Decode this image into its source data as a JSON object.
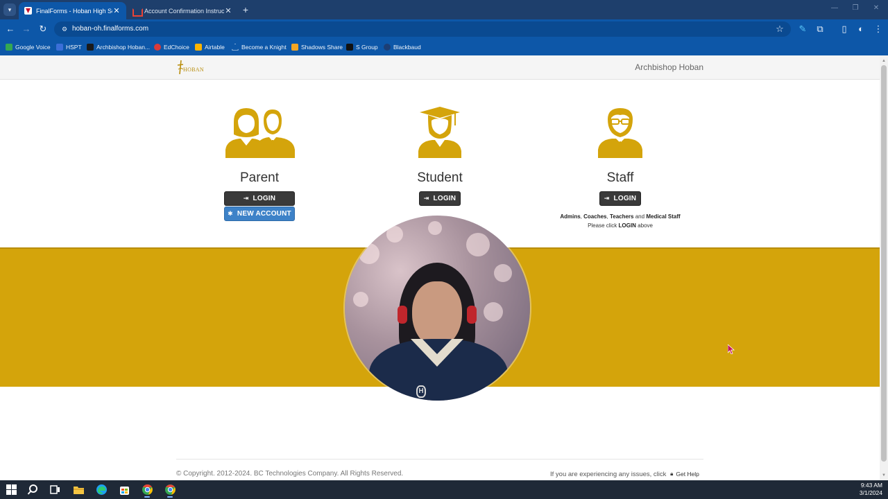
{
  "browser": {
    "tabs": [
      {
        "title": "FinalForms - Hoban High Scho",
        "active": true
      },
      {
        "title": "Account Confirmation Instructio",
        "active": false
      }
    ],
    "url": "hoban-oh.finalforms.com",
    "bookmarks": [
      {
        "label": "Google Voice",
        "color": "#34a853"
      },
      {
        "label": "HSPT",
        "color": "#3b6fd8"
      },
      {
        "label": "Archbishop Hoban...",
        "color": "#1a1a1a"
      },
      {
        "label": "EdChoice",
        "color": "#d93a3a"
      },
      {
        "label": "Airtable",
        "color": "#fcb400"
      },
      {
        "label": "Become a Knight",
        "color": "#ffffff"
      },
      {
        "label": "Shadows Share",
        "color": "#f5a623"
      },
      {
        "label": "S Group",
        "color": "#111111"
      },
      {
        "label": "Blackbaud",
        "color": "#1c3e75"
      }
    ]
  },
  "header": {
    "logo_word": "HOBAN",
    "school_name": "Archbishop Hoban"
  },
  "roles": {
    "parent": {
      "title": "Parent",
      "login_label": "LOGIN",
      "new_account_label": "NEW ACCOUNT"
    },
    "student": {
      "title": "Student",
      "login_label": "LOGIN"
    },
    "staff": {
      "title": "Staff",
      "login_label": "LOGIN",
      "note_roles": [
        "Admins",
        "Coaches",
        "Teachers",
        "Medical Staff"
      ],
      "note_and": "and",
      "note_sep": ",",
      "note_line2_pre": "Please click",
      "note_line2_login": "LOGIN",
      "note_line2_post": "above"
    }
  },
  "footer": {
    "copyright": "© Copyright. 2012-2024. BC Technologies Company. All Rights Reserved.",
    "help_text": "If you are experiencing any issues, click",
    "help_button": "Get Help"
  },
  "taskbar": {
    "time": "9:43 AM",
    "date": "3/1/2024"
  },
  "colors": {
    "gold": "#d4a40b",
    "browser_blue": "#0d57a8",
    "button_dark": "#3a3a3a",
    "button_blue": "#3d82c8"
  }
}
